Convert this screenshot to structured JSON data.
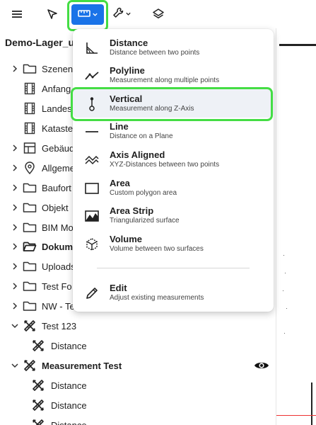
{
  "toolbar": {
    "menu_icon": "hamburger-menu-icon",
    "select_icon": "cursor-arrow-icon",
    "measure_icon": "ruler-icon",
    "tools_icon": "wrench-icon",
    "layers_icon": "layers-icon",
    "accent": "#1a73e8"
  },
  "project": {
    "title": "Demo-Lager_u"
  },
  "tree": [
    {
      "label": "Szenen",
      "icon": "folder-icon",
      "expandable": true
    },
    {
      "label": "Anfang",
      "icon": "film-icon",
      "expandable": false
    },
    {
      "label": "Landes",
      "icon": "film-icon",
      "expandable": false
    },
    {
      "label": "Kataste",
      "icon": "film-icon",
      "expandable": false
    },
    {
      "label": "Gebäud",
      "icon": "grid-icon",
      "expandable": true
    },
    {
      "label": "Allgeme",
      "icon": "location-pin-icon",
      "expandable": true
    },
    {
      "label": "Baufort",
      "icon": "folder-icon",
      "expandable": true
    },
    {
      "label": "Objekt",
      "icon": "folder-icon",
      "expandable": true
    },
    {
      "label": "BIM Mo",
      "icon": "folder-icon",
      "expandable": true
    },
    {
      "label": "Dokume",
      "icon": "folder-open-icon",
      "expandable": true
    },
    {
      "label": "Uploads",
      "icon": "folder-icon",
      "expandable": true
    },
    {
      "label": "Test Fo",
      "icon": "folder-icon",
      "expandable": true
    },
    {
      "label": "NW - Te",
      "icon": "folder-icon",
      "expandable": true
    },
    {
      "label": "Test 123",
      "icon": "measure-tool-icon",
      "expandable": true
    },
    {
      "label": "Distance",
      "icon": "measure-tool-icon",
      "expandable": false
    },
    {
      "label": "Measurement Test",
      "icon": "measure-tool-icon",
      "expandable": true
    },
    {
      "label": "Distance",
      "icon": "measure-tool-icon",
      "expandable": false
    },
    {
      "label": "Distance",
      "icon": "measure-tool-icon",
      "expandable": false
    },
    {
      "label": "Distance",
      "icon": "measure-tool-icon",
      "expandable": false
    }
  ],
  "measure_menu": {
    "items": [
      {
        "title": "Distance",
        "subtitle": "Distance between two points",
        "icon": "distance-angle-icon"
      },
      {
        "title": "Polyline",
        "subtitle": "Measurement along multiple points",
        "icon": "polyline-icon"
      },
      {
        "title": "Vertical",
        "subtitle": "Measurement along Z-Axis",
        "icon": "vertical-pin-icon"
      },
      {
        "title": "Line",
        "subtitle": "Distance on a Plane",
        "icon": "line-icon"
      },
      {
        "title": "Axis Aligned",
        "subtitle": "XYZ-Distances between two points",
        "icon": "axis-aligned-icon"
      },
      {
        "title": "Area",
        "subtitle": "Custom polygon area",
        "icon": "area-rectangle-icon"
      },
      {
        "title": "Area Strip",
        "subtitle": "Triangularized surface",
        "icon": "area-strip-icon"
      },
      {
        "title": "Volume",
        "subtitle": "Volume between two surfaces",
        "icon": "volume-cube-icon"
      }
    ],
    "edit": {
      "title": "Edit",
      "subtitle": "Adjust existing measurements",
      "icon": "pencil-icon"
    },
    "highlight_color": "#44dd44"
  }
}
